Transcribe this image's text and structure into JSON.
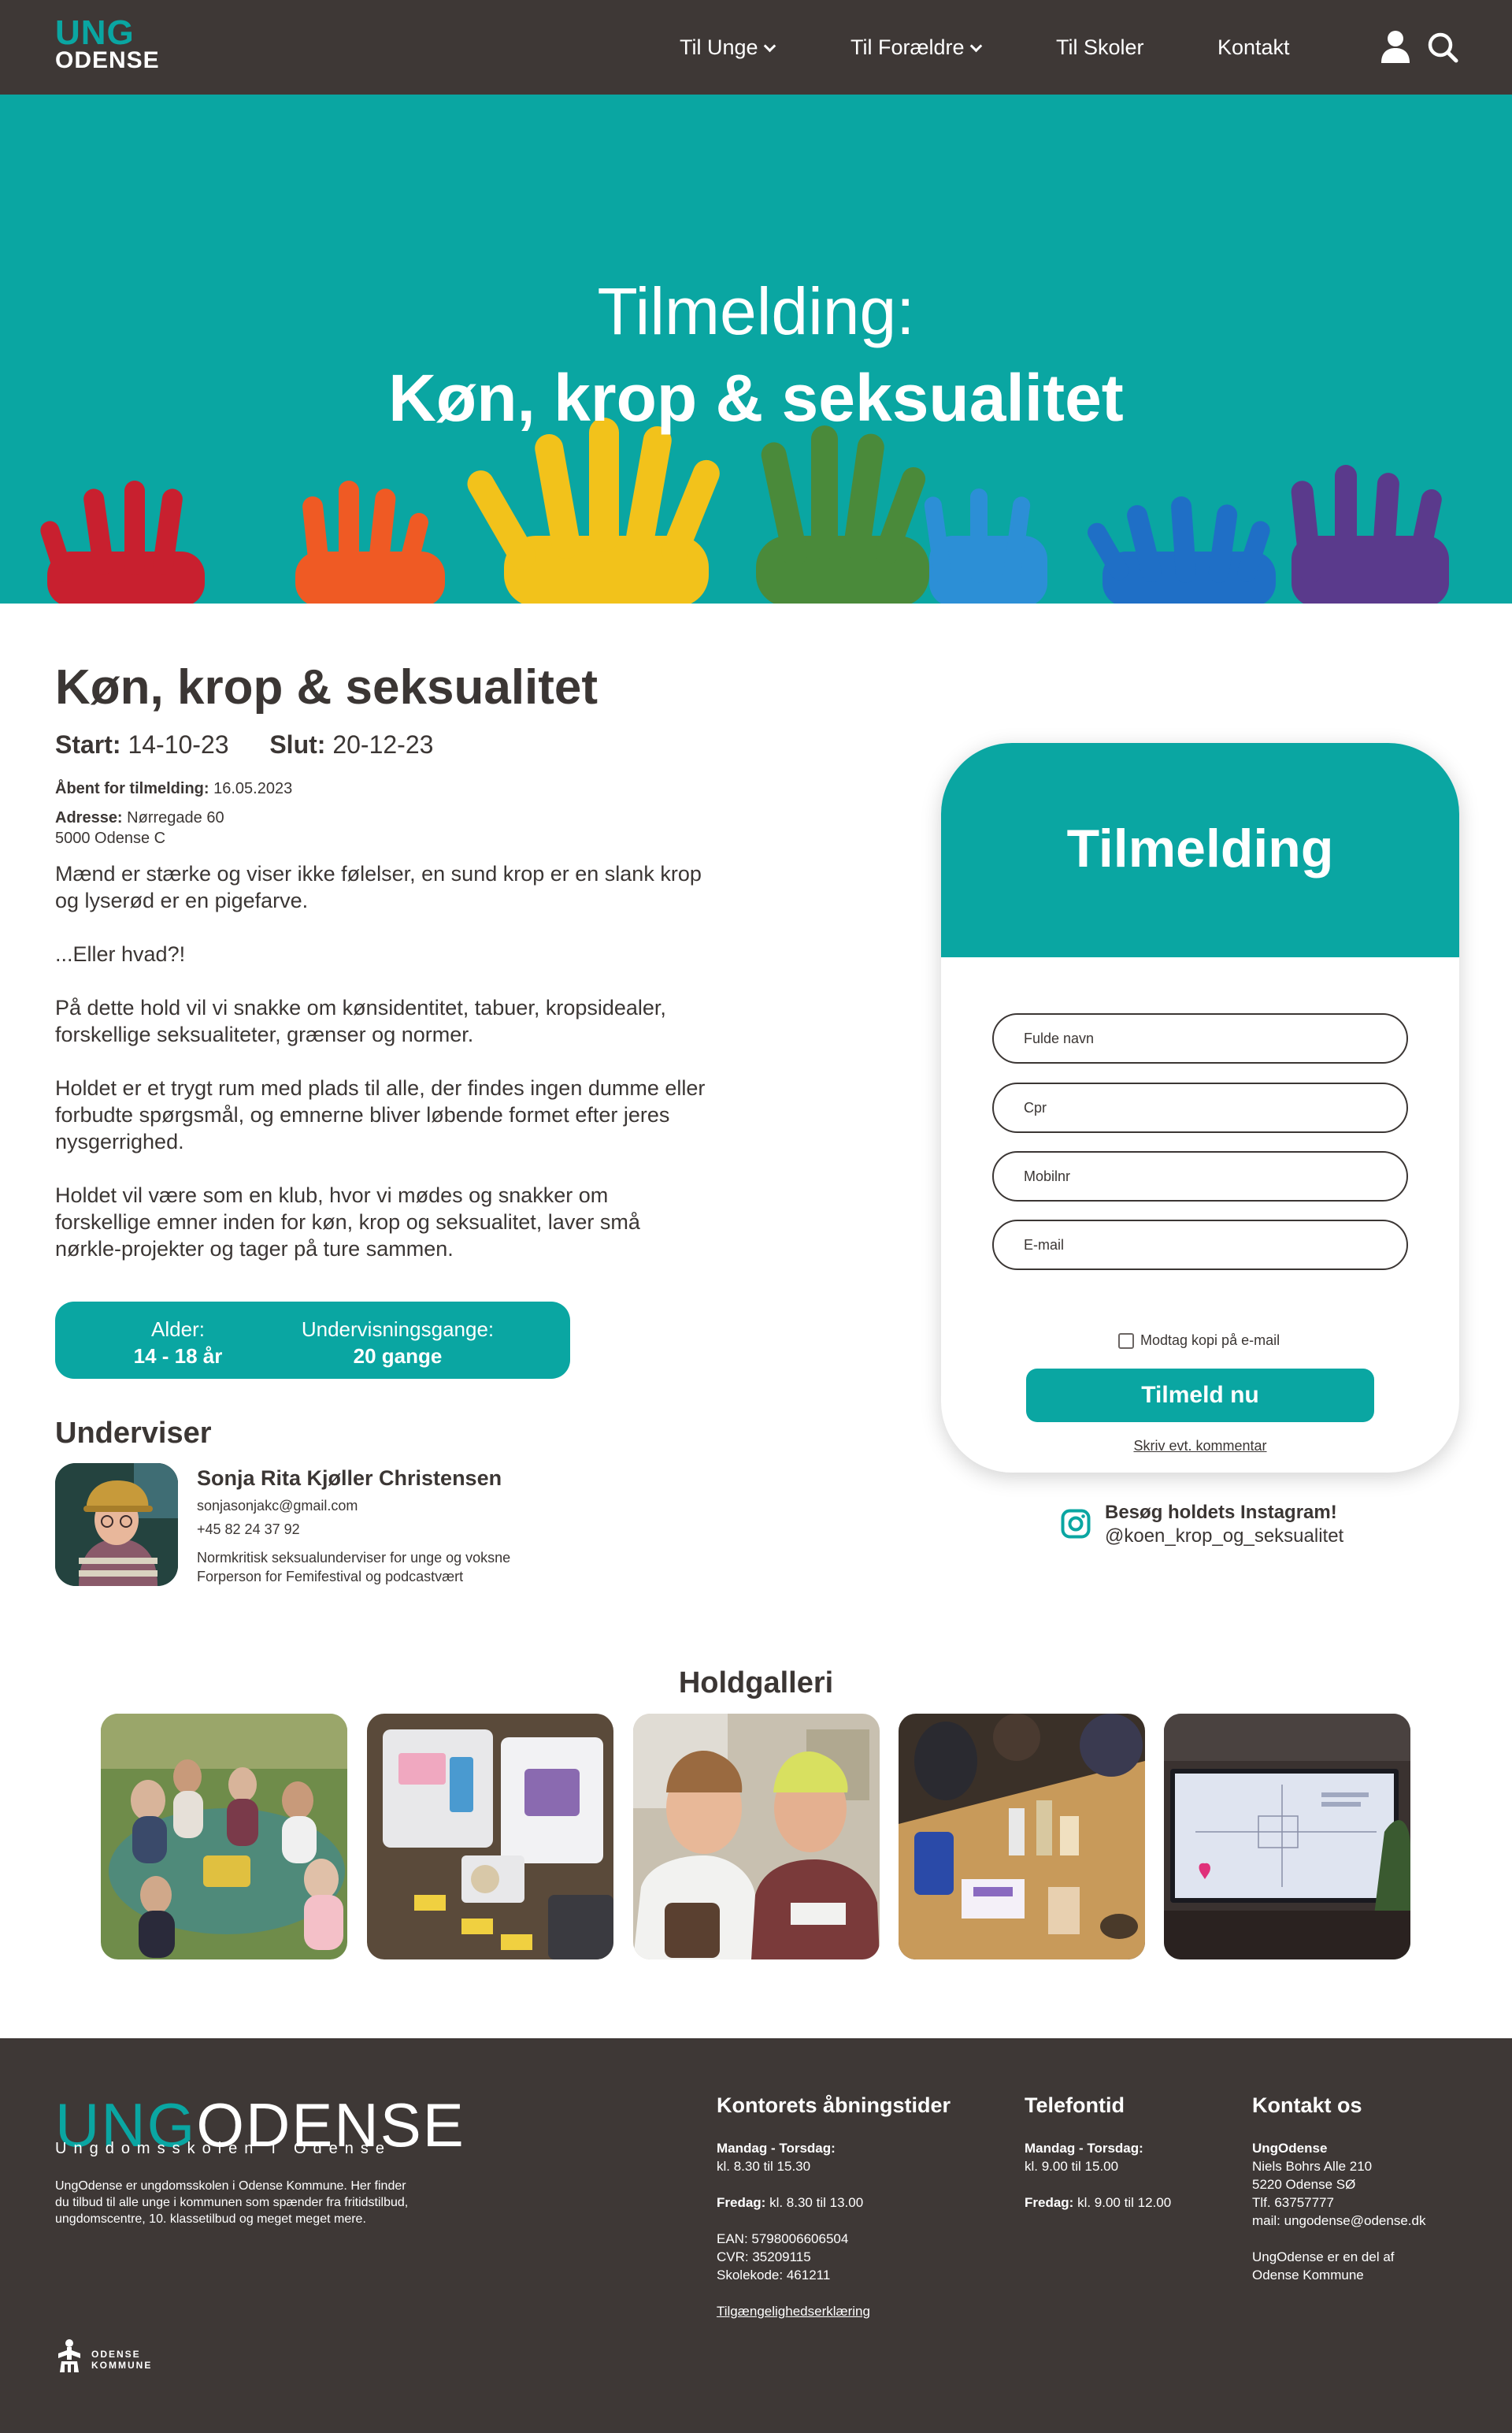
{
  "nav": {
    "logo_top": "UNG",
    "logo_bottom": "ODENSE",
    "items": [
      {
        "label": "Til Unge",
        "has_dropdown": true
      },
      {
        "label": "Til Forældre",
        "has_dropdown": true
      },
      {
        "label": "Til Skoler",
        "has_dropdown": false
      },
      {
        "label": "Kontakt",
        "has_dropdown": false
      }
    ],
    "user_icon": "user-icon",
    "search_icon": "search-icon"
  },
  "hero": {
    "line1": "Tilmelding:",
    "line2": "Køn, krop & seksualitet",
    "bg_color": "#0aa6a2"
  },
  "course": {
    "title": "Køn, krop & seksualitet",
    "start_label": "Start:",
    "start_value": "14-10-23",
    "end_label": "Slut:",
    "end_value": "20-12-23",
    "open_label": "Åbent for tilmelding:",
    "open_value": "16.05.2023",
    "address_label": "Adresse:",
    "address_line1": "Nørregade 60",
    "address_line2": "5000 Odense C",
    "description": [
      "Mænd er stærke og viser ikke følelser, en sund krop er en slank krop og lyserød er en pigefarve.",
      "...Eller hvad?!",
      "På dette hold vil vi snakke om kønsidentitet, tabuer, kropsidealer, forskellige seksualiteter, grænser og normer.",
      "Holdet er et trygt rum med plads til alle, der findes ingen dumme eller forbudte spørgsmål, og emnerne bliver løbende formet efter jeres nysgerrighed.",
      "Holdet vil være som en klub, hvor vi mødes og snakker om forskellige emner inden for køn, krop og seksualitet, laver små nørkle-projekter og tager på ture sammen."
    ],
    "age_label": "Alder:",
    "age_value": "14 - 18 år",
    "sessions_label": "Undervisningsgange:",
    "sessions_value": "20 gange"
  },
  "teacher": {
    "heading": "Underviser",
    "name": "Sonja Rita Kjøller Christensen",
    "email": "sonjasonjakc@gmail.com",
    "phone": "+45 82 24 37 92",
    "bio1": "Normkritisk seksualunderviser for unge og voksne",
    "bio2": "Forperson for Femifestival og podcastvært"
  },
  "form": {
    "title": "Tilmelding",
    "fields": [
      {
        "placeholder": "Fulde navn",
        "value": ""
      },
      {
        "placeholder": "Cpr",
        "value": ""
      },
      {
        "placeholder": "Mobilnr",
        "value": ""
      },
      {
        "placeholder": "E-mail",
        "value": ""
      }
    ],
    "copy_checkbox_label": "Modtag kopi på e-mail",
    "copy_checked": false,
    "submit_label": "Tilmeld nu",
    "comment_link": "Skriv evt. kommentar"
  },
  "instagram": {
    "icon": "instagram-icon",
    "title": "Besøg holdets Instagram!",
    "handle": "@koen_krop_og_seksualitet"
  },
  "gallery": {
    "heading": "Holdgalleri",
    "items": [
      "photo-group-on-lawn",
      "photo-craft-supplies",
      "photo-two-people-smiling",
      "photo-workshop-table",
      "photo-presentation-screen"
    ]
  },
  "footer": {
    "logo_ung": "UNG",
    "logo_odense": "ODENSE",
    "tagline": "Ungdomsskolen i Odense",
    "about": "UngOdense er ungdomsskolen i Odense Kommune. Her finder du tilbud til alle unge i kommunen som spænder fra fritidstilbud, ungdomscentre, 10. klassetilbud og meget meget mere.",
    "hours": {
      "heading": "Kontorets åbningstider",
      "days1": "Mandag - Torsdag:",
      "time1": "kl. 8.30 til 15.30",
      "days2": "Fredag:",
      "time2": "kl. 8.30 til 13.00",
      "ean": "EAN: 5798006606504",
      "cvr": "CVR: 35209115",
      "school_code": "Skolekode: 461211",
      "accessibility": "Tilgængelighedserklæring"
    },
    "phone": {
      "heading": "Telefontid",
      "days1": "Mandag - Torsdag:",
      "time1": "kl. 9.00 til 15.00",
      "days2": "Fredag:",
      "time2": "kl. 9.00 til 12.00"
    },
    "contact": {
      "heading": "Kontakt os",
      "name": "UngOdense",
      "street": "Niels Bohrs Alle 210",
      "city": "5220 Odense SØ",
      "tel": "Tlf. 63757777",
      "mail": "mail: ungodense@odense.dk",
      "note1": "UngOdense er en del af",
      "note2": "Odense Kommune"
    },
    "kommune_line1": "ODENSE",
    "kommune_line2": "KOMMUNE"
  },
  "colors": {
    "teal": "#0aa6a2",
    "dark": "#3e3836",
    "text": "#3b3634"
  }
}
